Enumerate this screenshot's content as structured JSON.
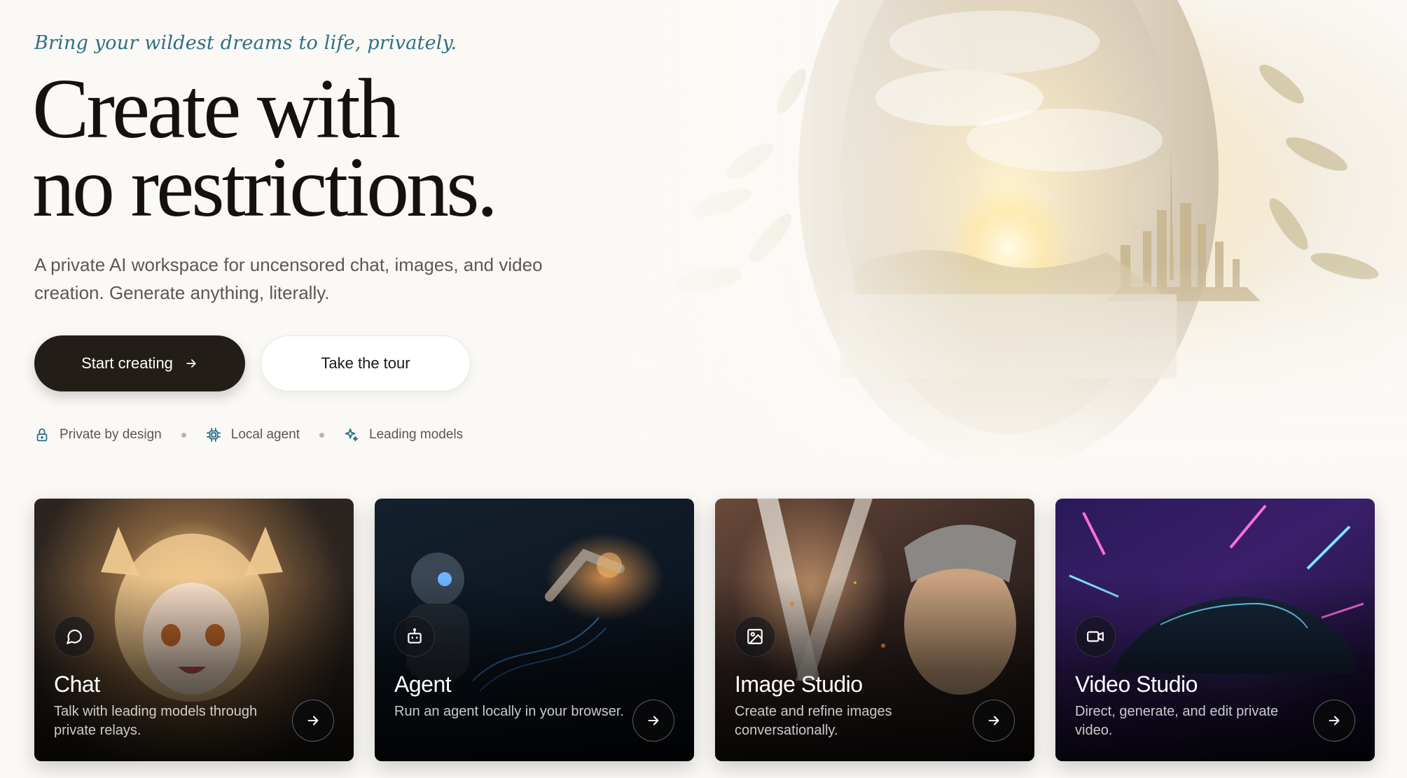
{
  "hero": {
    "tagline": "Bring your wildest dreams to life, privately.",
    "headline_line1": "Create with",
    "headline_line2": "no restrictions.",
    "subtitle_line1": "A private AI workspace for uncensored chat, images, and video",
    "subtitle_line2": "creation. Generate anything, literally.",
    "primary_button": "Start creating",
    "secondary_button": "Take the tour",
    "features": [
      {
        "label": "Private by design",
        "icon": "lock-icon"
      },
      {
        "label": "Local agent",
        "icon": "chip-icon"
      },
      {
        "label": "Leading models",
        "icon": "sparkles-icon"
      }
    ],
    "art_icon": "fantasy-portal-illustration"
  },
  "cards": [
    {
      "title": "Chat",
      "description": "Talk with leading models through private relays.",
      "icon": "chat-bubble-icon",
      "art": "anime-fox-girl"
    },
    {
      "title": "Agent",
      "description": "Run an agent locally in your browser.",
      "icon": "robot-icon",
      "art": "robot-and-robotic-arm"
    },
    {
      "title": "Image Studio",
      "description": "Create and refine images conversationally.",
      "icon": "image-icon",
      "art": "anime-swordsman"
    },
    {
      "title": "Video Studio",
      "description": "Direct, generate, and edit private video.",
      "icon": "video-camera-icon",
      "art": "neon-sports-car"
    }
  ],
  "colors": {
    "tagline": "#2e6f86",
    "primary_button_bg": "#221d17",
    "page_bg": "#fbf9f5"
  }
}
